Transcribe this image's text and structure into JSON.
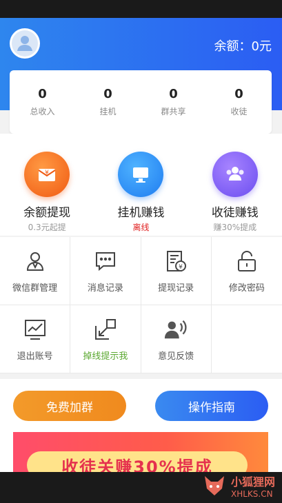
{
  "header": {
    "balance_label": "余额：0元"
  },
  "stats": [
    {
      "value": "0",
      "label": "总收入"
    },
    {
      "value": "0",
      "label": "挂机"
    },
    {
      "value": "0",
      "label": "群共享"
    },
    {
      "value": "0",
      "label": "收徒"
    }
  ],
  "features": [
    {
      "title": "余额提现",
      "sub": "0.3元起提",
      "icon": "wallet-icon"
    },
    {
      "title": "挂机赚钱",
      "sub": "离线",
      "icon": "monitor-icon"
    },
    {
      "title": "收徒赚钱",
      "sub": "赚30%提成",
      "icon": "users-icon"
    }
  ],
  "grid": [
    {
      "label": "微信群管理",
      "icon": "group-icon"
    },
    {
      "label": "消息记录",
      "icon": "message-icon"
    },
    {
      "label": "提现记录",
      "icon": "receipt-icon"
    },
    {
      "label": "修改密码",
      "icon": "lock-icon"
    },
    {
      "label": "退出账号",
      "icon": "chart-icon"
    },
    {
      "label": "掉线提示我",
      "icon": "expand-icon"
    },
    {
      "label": "意见反馈",
      "icon": "feedback-icon"
    }
  ],
  "actions": {
    "join_group": "免费加群",
    "guide": "操作指南"
  },
  "banner": {
    "text": "收徒关赚30%提成"
  },
  "watermark": {
    "cn": "小狐狸网",
    "en": "XHLKS.CN"
  },
  "colors": {
    "primary": "#2b5df3",
    "orange": "#f39a2a",
    "alert": "#e02020",
    "green": "#5aa82f"
  }
}
